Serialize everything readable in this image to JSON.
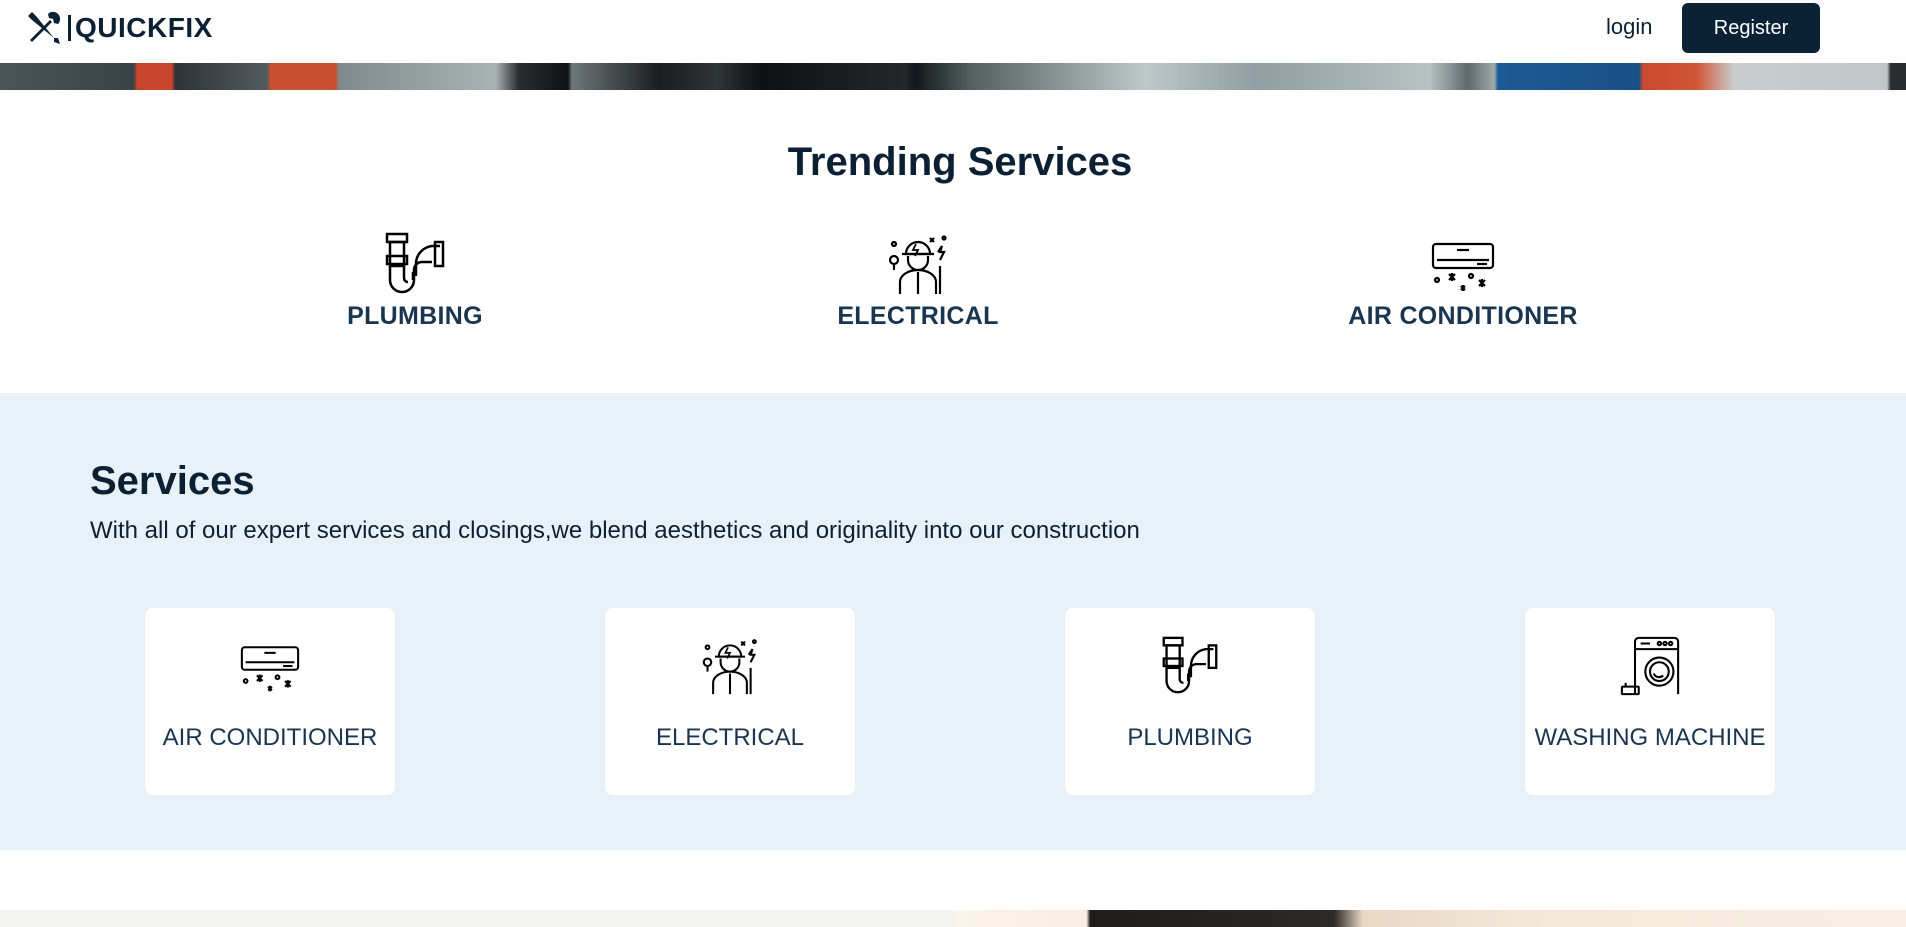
{
  "header": {
    "brand_name": "QUICKFIX",
    "brand_icon": "wrench-screwdriver-icon",
    "login_label": "login",
    "register_label": "Register"
  },
  "trending": {
    "title": "Trending Services",
    "items": [
      {
        "label": "PLUMBING",
        "icon": "pipe-icon"
      },
      {
        "label": "ELECTRICAL",
        "icon": "electrician-icon"
      },
      {
        "label": "AIR CONDITIONER",
        "icon": "air-conditioner-icon"
      }
    ]
  },
  "services": {
    "title": "Services",
    "subtitle": "With all of our expert services and closings,we blend aesthetics and originality into our construction",
    "cards": [
      {
        "label": "AIR CONDITIONER",
        "icon": "air-conditioner-icon"
      },
      {
        "label": "ELECTRICAL",
        "icon": "electrician-icon"
      },
      {
        "label": "PLUMBING",
        "icon": "pipe-icon"
      },
      {
        "label": "WASHING MACHINE",
        "icon": "washing-machine-icon"
      }
    ]
  },
  "colors": {
    "primary": "#0b2236",
    "text": "#0b2033",
    "services_bg": "#e9f1f8",
    "card_bg": "#ffffff"
  }
}
